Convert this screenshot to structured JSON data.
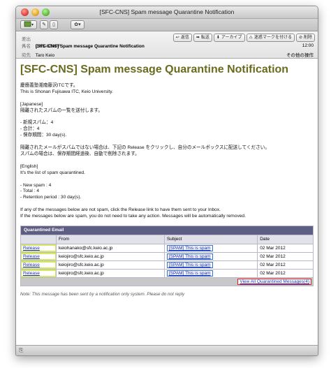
{
  "window": {
    "title": "[SFC-CNS] Spam message Quarantine Notification"
  },
  "header": {
    "from_label": "差出人",
    "from_value": "CNS-STAFF",
    "subject_label": "件名",
    "subject_value": "[SFC-CNS] Spam message Quarantine Notification",
    "to_label": "宛先",
    "to_value": "Taro Keio",
    "time": "12:00",
    "other_actions": "その他の操作",
    "buttons": {
      "reply": "返信",
      "forward": "転送",
      "archive": "アーカイブ",
      "junk": "迷惑マークを付ける",
      "delete": "削除"
    }
  },
  "body": {
    "title": "[SFC-CNS] Spam message Quarantine Notification",
    "text": "慶應義塾湘南藤沢ITCです。\nThis is Shonan Fujisawa ITC, Keio University.\n\n[Japanese]\n隔離されたスパムの一覧を送付します。\n\n- 新規スパム：4\n- 合計：4\n- 保存期間：30 day(s).\n\n隔離されたメールがスパムではない場合は、下記の Release をクリックし、自分のメールボックスに配送してください。\nスパムの場合は、保存期間経過後、自動で削除されます。\n\n[English]\nIt's the list of spam quarantined.\n\n- New spam : 4\n- Total : 4\n- Retention period : 30 day(s).\n\nIf any of the messages below are not spam, click the Release link to have them sent to your Inbox.\nIf the messages below are spam, you do not need to take any action. Messages will be automatically removed.",
    "table": {
      "caption": "Quarantined Email",
      "columns": [
        "",
        "From",
        "Subject",
        "Date"
      ],
      "rows": [
        {
          "action": "Release",
          "from": "keiohanako@sfc.keio.ac.jp",
          "subject": "[SPAM] This is spam",
          "date": "02 Mar 2012"
        },
        {
          "action": "Release",
          "from": "keiojiro@sfc.keio.ac.jp",
          "subject": "[SPAM] This is spam",
          "date": "02 Mar 2012"
        },
        {
          "action": "Release",
          "from": "keiojiro@sfc.keio.ac.jp",
          "subject": "[SPAM] This is spam",
          "date": "02 Mar 2012"
        },
        {
          "action": "Release",
          "from": "keiojiro@sfc.keio.ac.jp",
          "subject": "[SPAM] This is spam",
          "date": "02 Mar 2012"
        }
      ],
      "view_all": "View All Quarantined Messages(4)"
    },
    "note": "Note: This message has been sent by a notification only system. Please do not reply"
  },
  "colors": {
    "title": "#6b6b1f",
    "table_header": "#5e5e84",
    "release_highlight": "#d8e86a",
    "view_all_border": "#e02020"
  }
}
